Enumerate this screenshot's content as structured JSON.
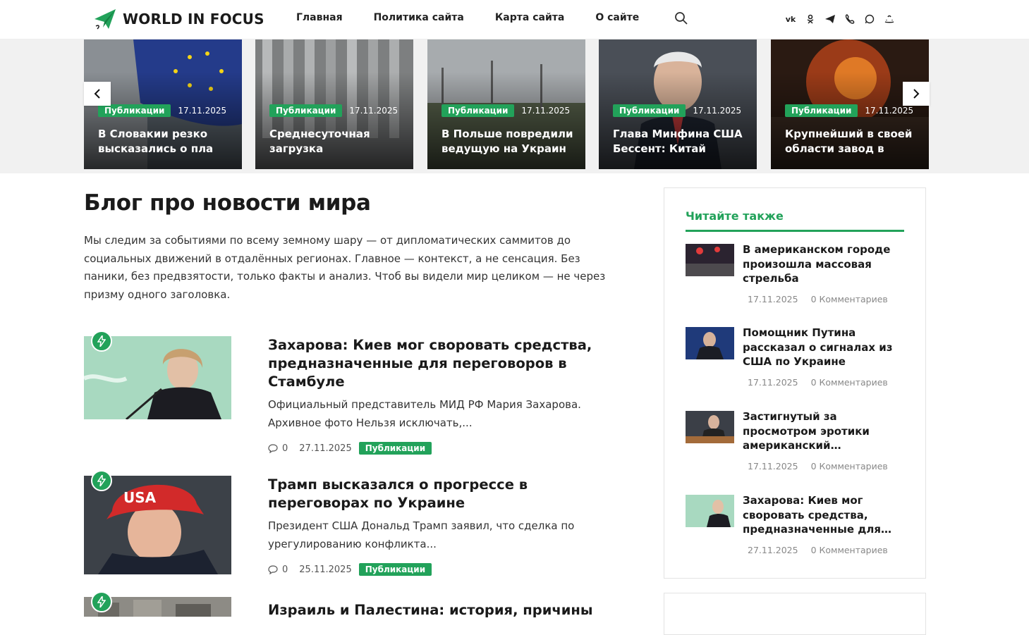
{
  "header": {
    "logo_text": "WORLD IN FOCUS",
    "nav": [
      "Главная",
      "Политика сайта",
      "Карта сайта",
      "О сайте"
    ],
    "socials": [
      "vk-icon",
      "ok-icon",
      "telegram-icon",
      "viber-icon",
      "whatsapp-icon",
      "max-icon"
    ]
  },
  "slider": {
    "slides": [
      {
        "category": "Публикации",
        "date": "17.11.2025",
        "title": "В Словакии резко высказались о пла"
      },
      {
        "category": "Публикации",
        "date": "17.11.2025",
        "title": "Среднесуточная загрузка"
      },
      {
        "category": "Публикации",
        "date": "17.11.2025",
        "title": "В Польше повредили ведущую на Украин"
      },
      {
        "category": "Публикации",
        "date": "17.11.2025",
        "title": "Глава Минфина США Бессент: Китай"
      },
      {
        "category": "Публикации",
        "date": "17.11.2025",
        "title": "Крупнейший в своей области завод в"
      }
    ]
  },
  "main": {
    "title": "Блог про новости мира",
    "intro": "Мы следим за событиями по всему земному шару — от дипломатических саммитов до социальных движений в отдалённых регионах. Главное — контекст, а не сенсация. Без паники, без предвзятости, только факты и анализ. Чтоб вы видели мир целиком — не через призму одного заголовка.",
    "posts": [
      {
        "title": "Захарова: Киев мог своровать средства, предназначенные для переговоров в Стамбуле",
        "excerpt": "Официальный представитель МИД РФ Мария Захарова. Архивное фото Нельзя исключать,...",
        "comments": "0",
        "date": "27.11.2025",
        "category": "Публикации"
      },
      {
        "title": "Трамп высказался о прогрессе в переговорах по Украине",
        "excerpt": "Президент США Дональд Трамп заявил, что сделка по урегулированию конфликта...",
        "comments": "0",
        "date": "25.11.2025",
        "category": "Публикации"
      },
      {
        "title": "Израиль и Палестина: история, причины",
        "excerpt": "",
        "comments": "",
        "date": "",
        "category": ""
      }
    ]
  },
  "sidebar": {
    "title": "Читайте также",
    "items": [
      {
        "title": "В американском городе произошла массовая стрельба",
        "date": "17.11.2025",
        "comments": "0 Комментариев"
      },
      {
        "title": "Помощник Путина рассказал о сигналах из США по Украине",
        "date": "17.11.2025",
        "comments": "0 Комментариев"
      },
      {
        "title": "Застигнутый за просмотром эротики американский…",
        "date": "17.11.2025",
        "comments": "0 Комментариев"
      },
      {
        "title": "Захарова: Киев мог своровать средства, предназначенные для…",
        "date": "27.11.2025",
        "comments": "0 Комментариев"
      }
    ]
  },
  "colors": {
    "accent": "#22a25a"
  }
}
